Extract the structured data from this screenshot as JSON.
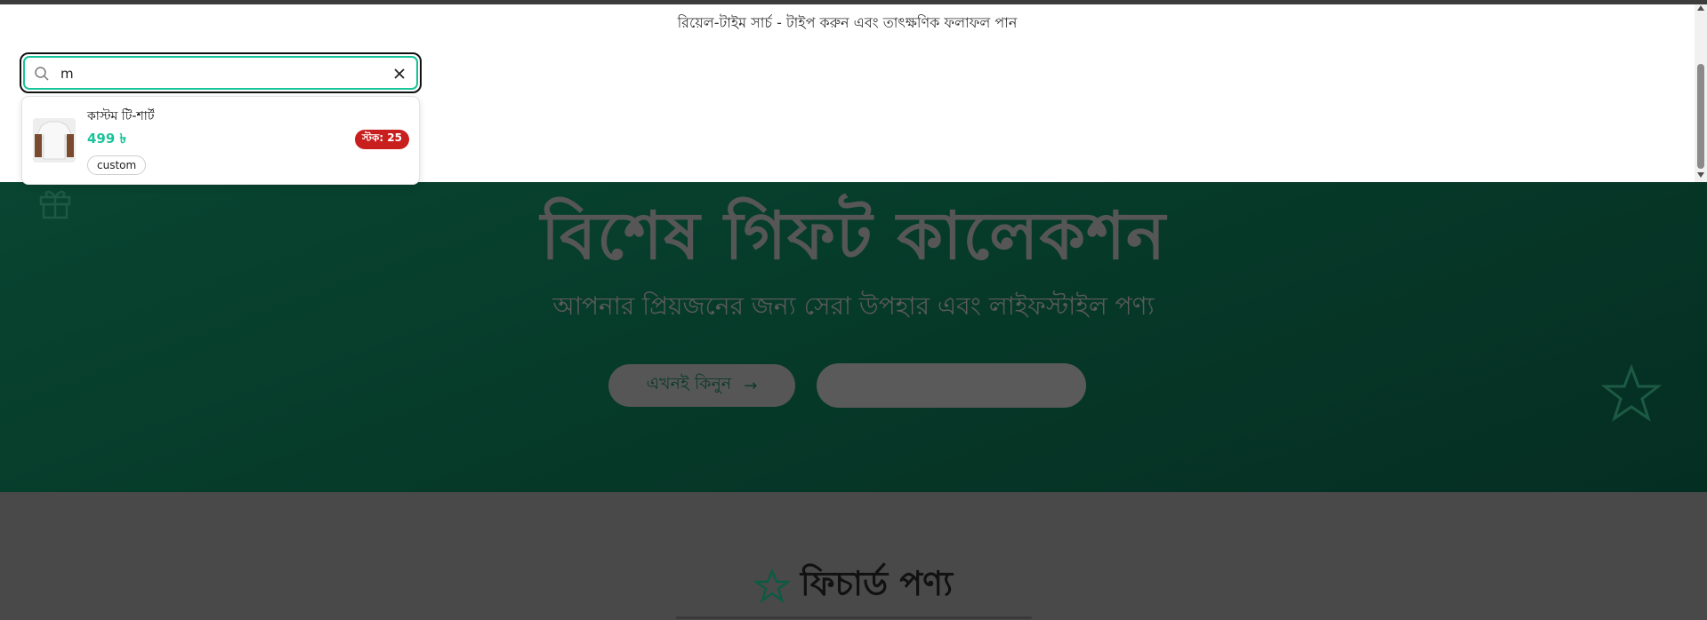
{
  "overlay": {
    "hint": "রিয়েল-টাইম সার্চ - টাইপ করুন এবং তাৎক্ষণিক ফলাফল পান"
  },
  "search": {
    "value": "m",
    "placeholder": ""
  },
  "results": [
    {
      "name": "কাস্টম টি-শার্ট",
      "price": "499 ৳",
      "stock": "স্টক: 25",
      "tag": "custom"
    }
  ],
  "hero": {
    "title": "বিশেষ গিফট কালেকশন",
    "subtitle": "আপনার প্রিয়জনের জন্য সেরা উপহার এবং লাইফস্টাইল পণ্য",
    "primary_button": "এখনই কিনুন",
    "primary_arrow": "→"
  },
  "featured": {
    "heading": "ফিচার্ড পণ্য"
  },
  "colors": {
    "accent": "#19c49a",
    "stock_badge": "#c81e1e",
    "hero_bg": "#0a4a35"
  }
}
